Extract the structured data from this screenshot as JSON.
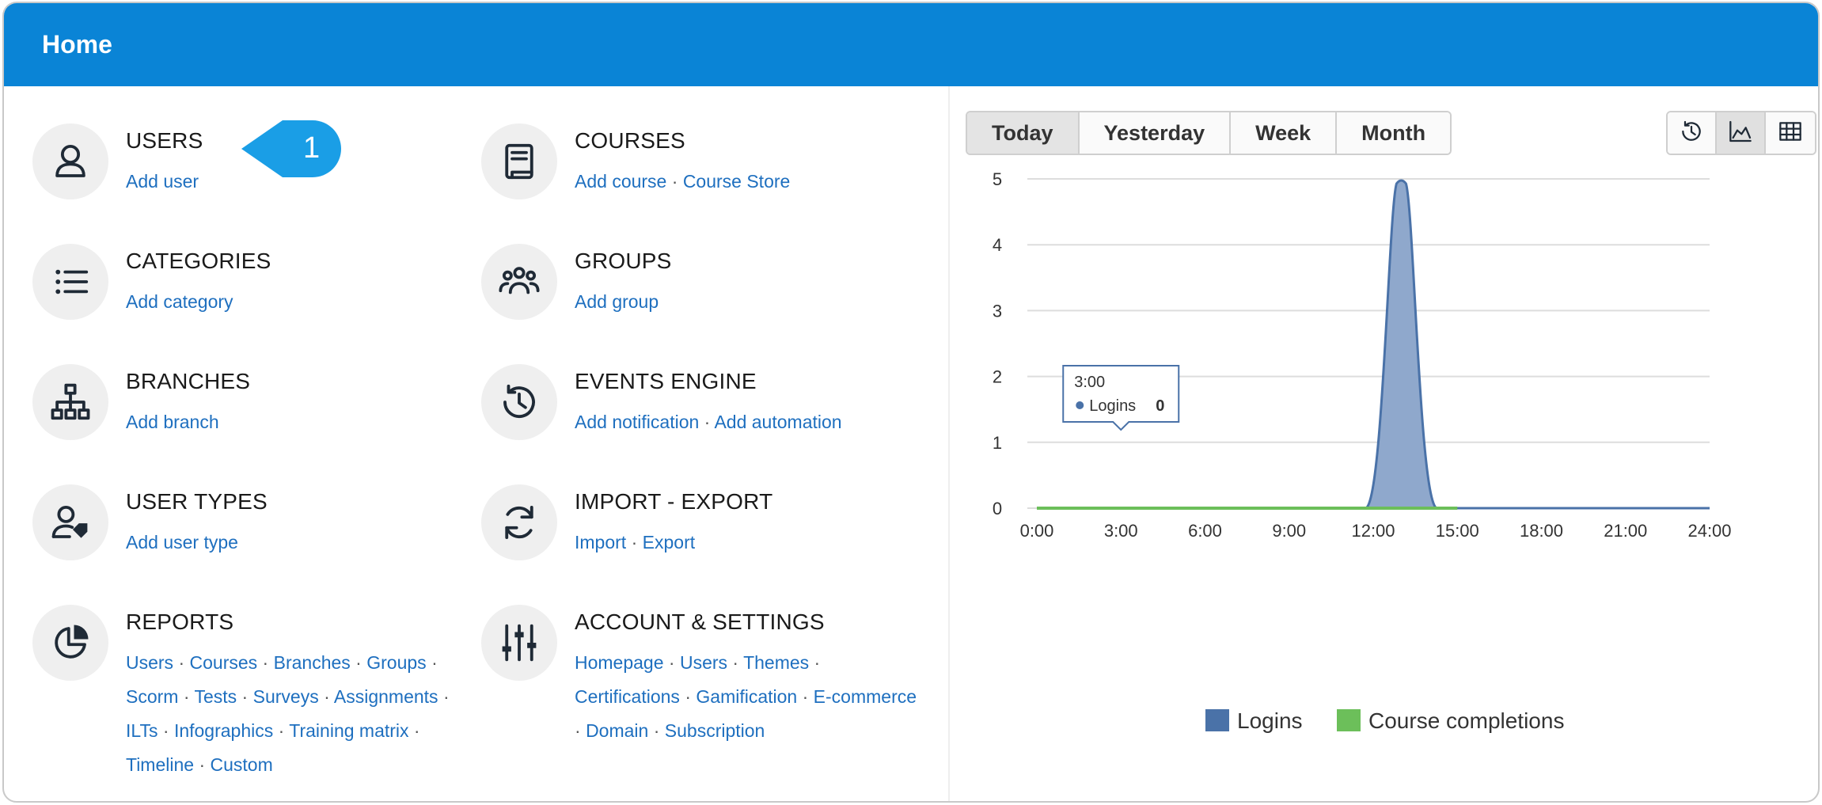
{
  "header": {
    "title": "Home"
  },
  "badge": {
    "number": "1",
    "color": "#1a9ee6"
  },
  "tiles": [
    {
      "name": "USERS",
      "icon": "user-icon",
      "links": [
        "Add user"
      ]
    },
    {
      "name": "COURSES",
      "icon": "book-icon",
      "links": [
        "Add course",
        "Course Store"
      ]
    },
    {
      "name": "CATEGORIES",
      "icon": "list-icon",
      "links": [
        "Add category"
      ]
    },
    {
      "name": "GROUPS",
      "icon": "people-group-icon",
      "links": [
        "Add group"
      ]
    },
    {
      "name": "BRANCHES",
      "icon": "sitemap-icon",
      "links": [
        "Add branch"
      ]
    },
    {
      "name": "EVENTS ENGINE",
      "icon": "history-icon",
      "links": [
        "Add notification",
        "Add automation"
      ]
    },
    {
      "name": "USER TYPES",
      "icon": "user-tag-icon",
      "links": [
        "Add user type"
      ]
    },
    {
      "name": "IMPORT - EXPORT",
      "icon": "sync-icon",
      "links": [
        "Import",
        "Export"
      ]
    },
    {
      "name": "REPORTS",
      "icon": "pie-chart-icon",
      "links": [
        "Users",
        "Courses",
        "Branches",
        "Groups",
        "Scorm",
        "Tests",
        "Surveys",
        "Assignments",
        "ILTs",
        "Infographics",
        "Training matrix",
        "Timeline",
        "Custom"
      ]
    },
    {
      "name": "ACCOUNT & SETTINGS",
      "icon": "sliders-icon",
      "links": [
        "Homepage",
        "Users",
        "Themes",
        "Certifications",
        "Gamification",
        "E-commerce",
        "Domain",
        "Subscription"
      ]
    }
  ],
  "range_tabs": [
    {
      "label": "Today",
      "active": true
    },
    {
      "label": "Yesterday",
      "active": false
    },
    {
      "label": "Week",
      "active": false
    },
    {
      "label": "Month",
      "active": false
    }
  ],
  "view_buttons": [
    {
      "icon": "history-icon",
      "active": false
    },
    {
      "icon": "area-chart-icon",
      "active": true
    },
    {
      "icon": "table-icon",
      "active": false
    }
  ],
  "tooltip": {
    "time": "3:00",
    "series": "Logins",
    "value": "0"
  },
  "chart_data": {
    "type": "area",
    "x_labels": [
      "0:00",
      "3:00",
      "6:00",
      "9:00",
      "12:00",
      "15:00",
      "18:00",
      "21:00",
      "24:00"
    ],
    "x_range": [
      0,
      24
    ],
    "y_ticks": [
      "0",
      "1",
      "2",
      "3",
      "4",
      "5"
    ],
    "ylim": [
      0,
      5
    ],
    "grid": true,
    "legend_position": "bottom",
    "series": [
      {
        "name": "Logins",
        "color": "#4a72a8",
        "x": [
          0,
          11.5,
          12,
          13,
          14,
          14.5,
          24
        ],
        "y": [
          0,
          0,
          0,
          5,
          0,
          0,
          0
        ]
      },
      {
        "name": "Course completions",
        "color": "#6cbf5a",
        "x": [
          0,
          15
        ],
        "y": [
          0,
          0
        ]
      }
    ]
  }
}
